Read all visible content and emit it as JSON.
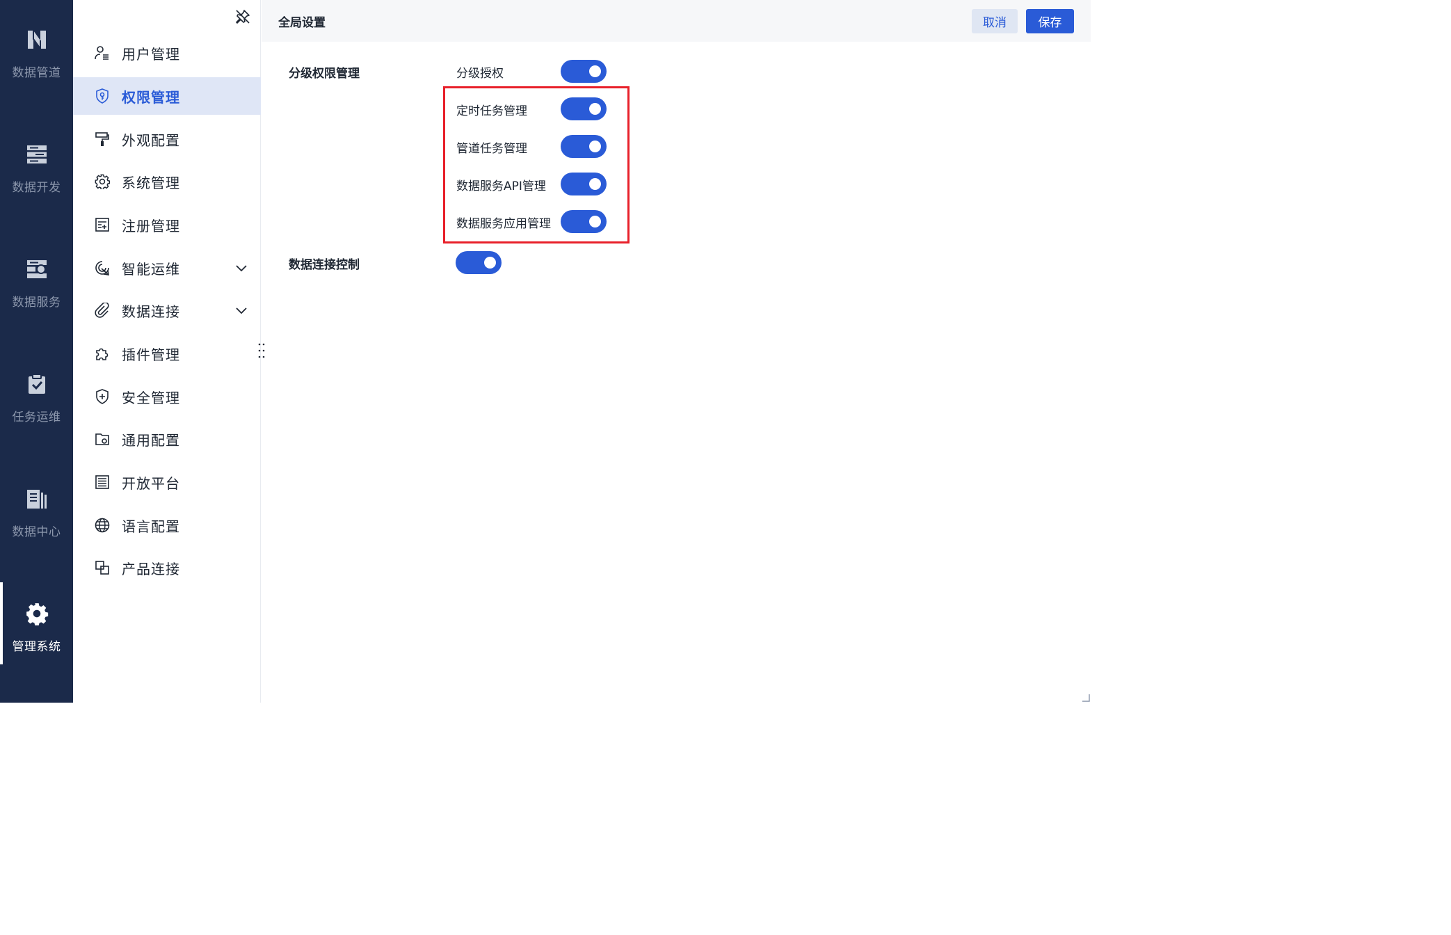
{
  "rail": {
    "items": [
      {
        "label": "数据管道",
        "icon": "pipeline-icon"
      },
      {
        "label": "数据开发",
        "icon": "server-stack-icon"
      },
      {
        "label": "数据服务",
        "icon": "service-icon"
      },
      {
        "label": "任务运维",
        "icon": "clipboard-check-icon"
      },
      {
        "label": "数据中心",
        "icon": "data-center-icon"
      },
      {
        "label": "管理系统",
        "icon": "gear-icon",
        "active": true
      }
    ]
  },
  "menu": {
    "items": [
      {
        "label": "用户管理",
        "icon": "user-list-icon"
      },
      {
        "label": "权限管理",
        "icon": "shield-key-icon",
        "active": true
      },
      {
        "label": "外观配置",
        "icon": "paint-roller-icon"
      },
      {
        "label": "系统管理",
        "icon": "gear-icon"
      },
      {
        "label": "注册管理",
        "icon": "register-doc-icon"
      },
      {
        "label": "智能运维",
        "icon": "smart-ops-icon",
        "expandable": true
      },
      {
        "label": "数据连接",
        "icon": "paperclip-icon",
        "expandable": true
      },
      {
        "label": "插件管理",
        "icon": "puzzle-icon"
      },
      {
        "label": "安全管理",
        "icon": "shield-plus-icon"
      },
      {
        "label": "通用配置",
        "icon": "folder-gear-icon"
      },
      {
        "label": "开放平台",
        "icon": "list-doc-icon"
      },
      {
        "label": "语言配置",
        "icon": "globe-icon"
      },
      {
        "label": "产品连接",
        "icon": "link-squares-icon"
      }
    ]
  },
  "header": {
    "title": "全局设置",
    "cancel_label": "取消",
    "save_label": "保存"
  },
  "settings": {
    "section1_label": "分级权限管理",
    "section2_label": "数据连接控制",
    "rows": [
      {
        "label": "分级授权",
        "on": true
      },
      {
        "label": "定时任务管理",
        "on": true
      },
      {
        "label": "管道任务管理",
        "on": true
      },
      {
        "label": "数据服务API管理",
        "on": true
      },
      {
        "label": "数据服务应用管理",
        "on": true
      }
    ],
    "data_connection_on": true
  },
  "colors": {
    "rail_bg": "#1b2a4a",
    "accent": "#2a5bd7",
    "active_menu_bg": "#dfe6f6",
    "highlight_border": "#e8202a"
  }
}
